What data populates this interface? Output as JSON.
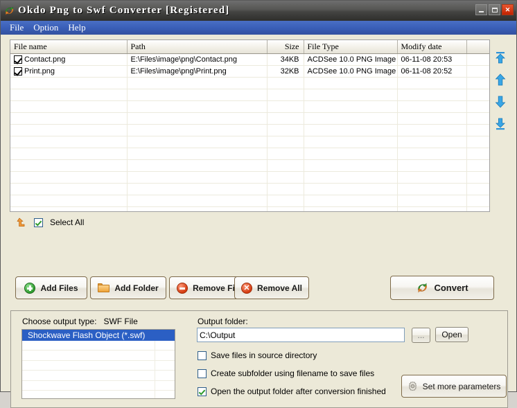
{
  "window": {
    "title": "Okdo Png to Swf Converter [Registered]",
    "app_icon": "convert-arrows-icon",
    "controls": {
      "minimize": "minimize-button",
      "maximize": "maximize-button",
      "close": "close-button"
    }
  },
  "menubar": {
    "items": [
      {
        "label": "File"
      },
      {
        "label": "Option"
      },
      {
        "label": "Help"
      }
    ]
  },
  "file_table": {
    "columns": [
      {
        "label": "File name",
        "align": "left"
      },
      {
        "label": "Path",
        "align": "left"
      },
      {
        "label": "Size",
        "align": "right"
      },
      {
        "label": "File Type",
        "align": "left"
      },
      {
        "label": "Modify date",
        "align": "left"
      },
      {
        "label": "",
        "align": "left"
      }
    ],
    "rows": [
      {
        "checked": true,
        "name": "Contact.png",
        "path": "E:\\Files\\image\\png\\Contact.png",
        "size": "34KB",
        "type": "ACDSee 10.0 PNG Image",
        "modified": "06-11-08 20:53"
      },
      {
        "checked": true,
        "name": "Print.png",
        "path": "E:\\Files\\image\\png\\Print.png",
        "size": "32KB",
        "type": "ACDSee 10.0 PNG Image",
        "modified": "06-11-08 20:52"
      }
    ],
    "empty_row_count": 12
  },
  "order_buttons": [
    {
      "name": "move-to-top-button",
      "icon": "arrow-to-top-icon"
    },
    {
      "name": "move-up-button",
      "icon": "arrow-up-icon"
    },
    {
      "name": "move-down-button",
      "icon": "arrow-down-icon"
    },
    {
      "name": "move-to-bottom-button",
      "icon": "arrow-to-bottom-icon"
    }
  ],
  "select_all": {
    "label": "Select All",
    "checked": true,
    "icon": "orange-up-arrow-icon"
  },
  "actions": {
    "add_files": {
      "label": "Add Files",
      "icon": "green-plus-icon"
    },
    "add_folder": {
      "label": "Add Folder",
      "icon": "folder-icon"
    },
    "remove_file": {
      "label": "Remove File",
      "icon": "red-minus-icon"
    },
    "remove_all": {
      "label": "Remove All",
      "icon": "red-x-icon"
    },
    "convert": {
      "label": "Convert",
      "icon": "convert-arrows-icon"
    }
  },
  "output_panel": {
    "choose_label": "Choose output type:",
    "chosen_type": "SWF File",
    "types": [
      {
        "label": "Shockwave Flash Object (*.swf)",
        "selected": true
      }
    ],
    "output_folder_label": "Output folder:",
    "output_folder_value": "C:\\Output",
    "output_folder_placeholder": "C:\\Output",
    "browse_label": "...",
    "open_label": "Open",
    "options": [
      {
        "label": "Save files in source directory",
        "checked": false
      },
      {
        "label": "Create subfolder using filename to save files",
        "checked": false
      },
      {
        "label": "Open the output folder after conversion finished",
        "checked": true
      }
    ],
    "set_params": {
      "label": "Set more parameters",
      "icon": "gear-icon"
    }
  },
  "colors": {
    "titlebar": "#4b4b49",
    "menubar": "#3a5fb8",
    "selection": "#2b5fc4",
    "button_border": "#7d6a4a",
    "arrow_blue": "#2f93d8",
    "accent_orange": "#e8802a",
    "accent_green": "#2f9b2f"
  }
}
